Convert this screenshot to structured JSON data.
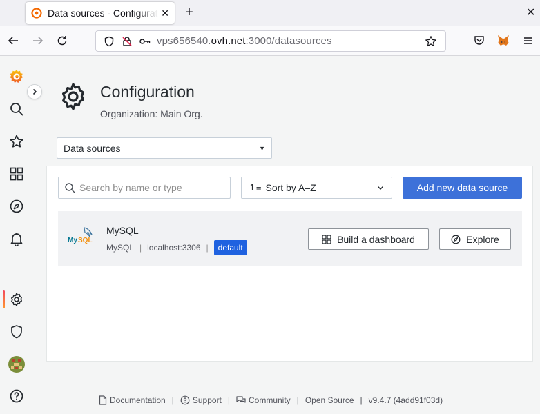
{
  "browser": {
    "tab_title": "Data sources - Configuration - Grafana",
    "new_tab": "+",
    "url_host_pre": "vps656540.",
    "url_host": "ovh.net",
    "url_path": ":3000/datasources"
  },
  "sidebar": {
    "items": [
      "grafana-logo",
      "search-icon",
      "starred-icon",
      "dashboards-icon",
      "explore-icon",
      "alerting-icon",
      "configuration-icon",
      "server-admin-icon",
      "user-avatar",
      "help-icon"
    ]
  },
  "header": {
    "title": "Configuration",
    "subtitle": "Organization: Main Org.",
    "section_select": "Data sources"
  },
  "toolbar": {
    "search_placeholder": "Search by name or type",
    "sort_label": "Sort by A–Z",
    "add_label": "Add new data source"
  },
  "datasources": [
    {
      "name": "MySQL",
      "type": "MySQL",
      "url": "localhost:3306",
      "badge": "default",
      "build_label": "Build a dashboard",
      "explore_label": "Explore"
    }
  ],
  "footer": {
    "documentation": "Documentation",
    "support": "Support",
    "community": "Community",
    "open_source": "Open Source",
    "version": "v9.4.7 (4add91f03d)"
  },
  "colors": {
    "primary": "#3d71d9",
    "badge": "#1f62e0"
  }
}
